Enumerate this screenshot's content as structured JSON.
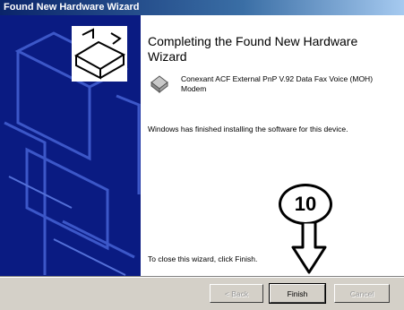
{
  "window": {
    "title": "Found New Hardware Wizard"
  },
  "content": {
    "heading": "Completing the Found New Hardware Wizard",
    "device_name": "Conexant ACF External PnP V.92 Data Fax Voice (MOH) Modem",
    "status_text": "Windows has finished installing the software for this device.",
    "close_instruction": "To close this wizard, click Finish."
  },
  "buttons": {
    "back": "< Back",
    "finish": "Finish",
    "cancel": "Cancel"
  },
  "annotation": {
    "step_number": "10"
  },
  "colors": {
    "title_bar": "#0a246a",
    "left_panel": "#0a1b82",
    "dialog_bg": "#d4d0c8"
  },
  "icons": {
    "wizard_art": "hardware-wizard-graphic",
    "device": "modem-device-icon",
    "callout_arrow": "down-arrow-icon"
  }
}
